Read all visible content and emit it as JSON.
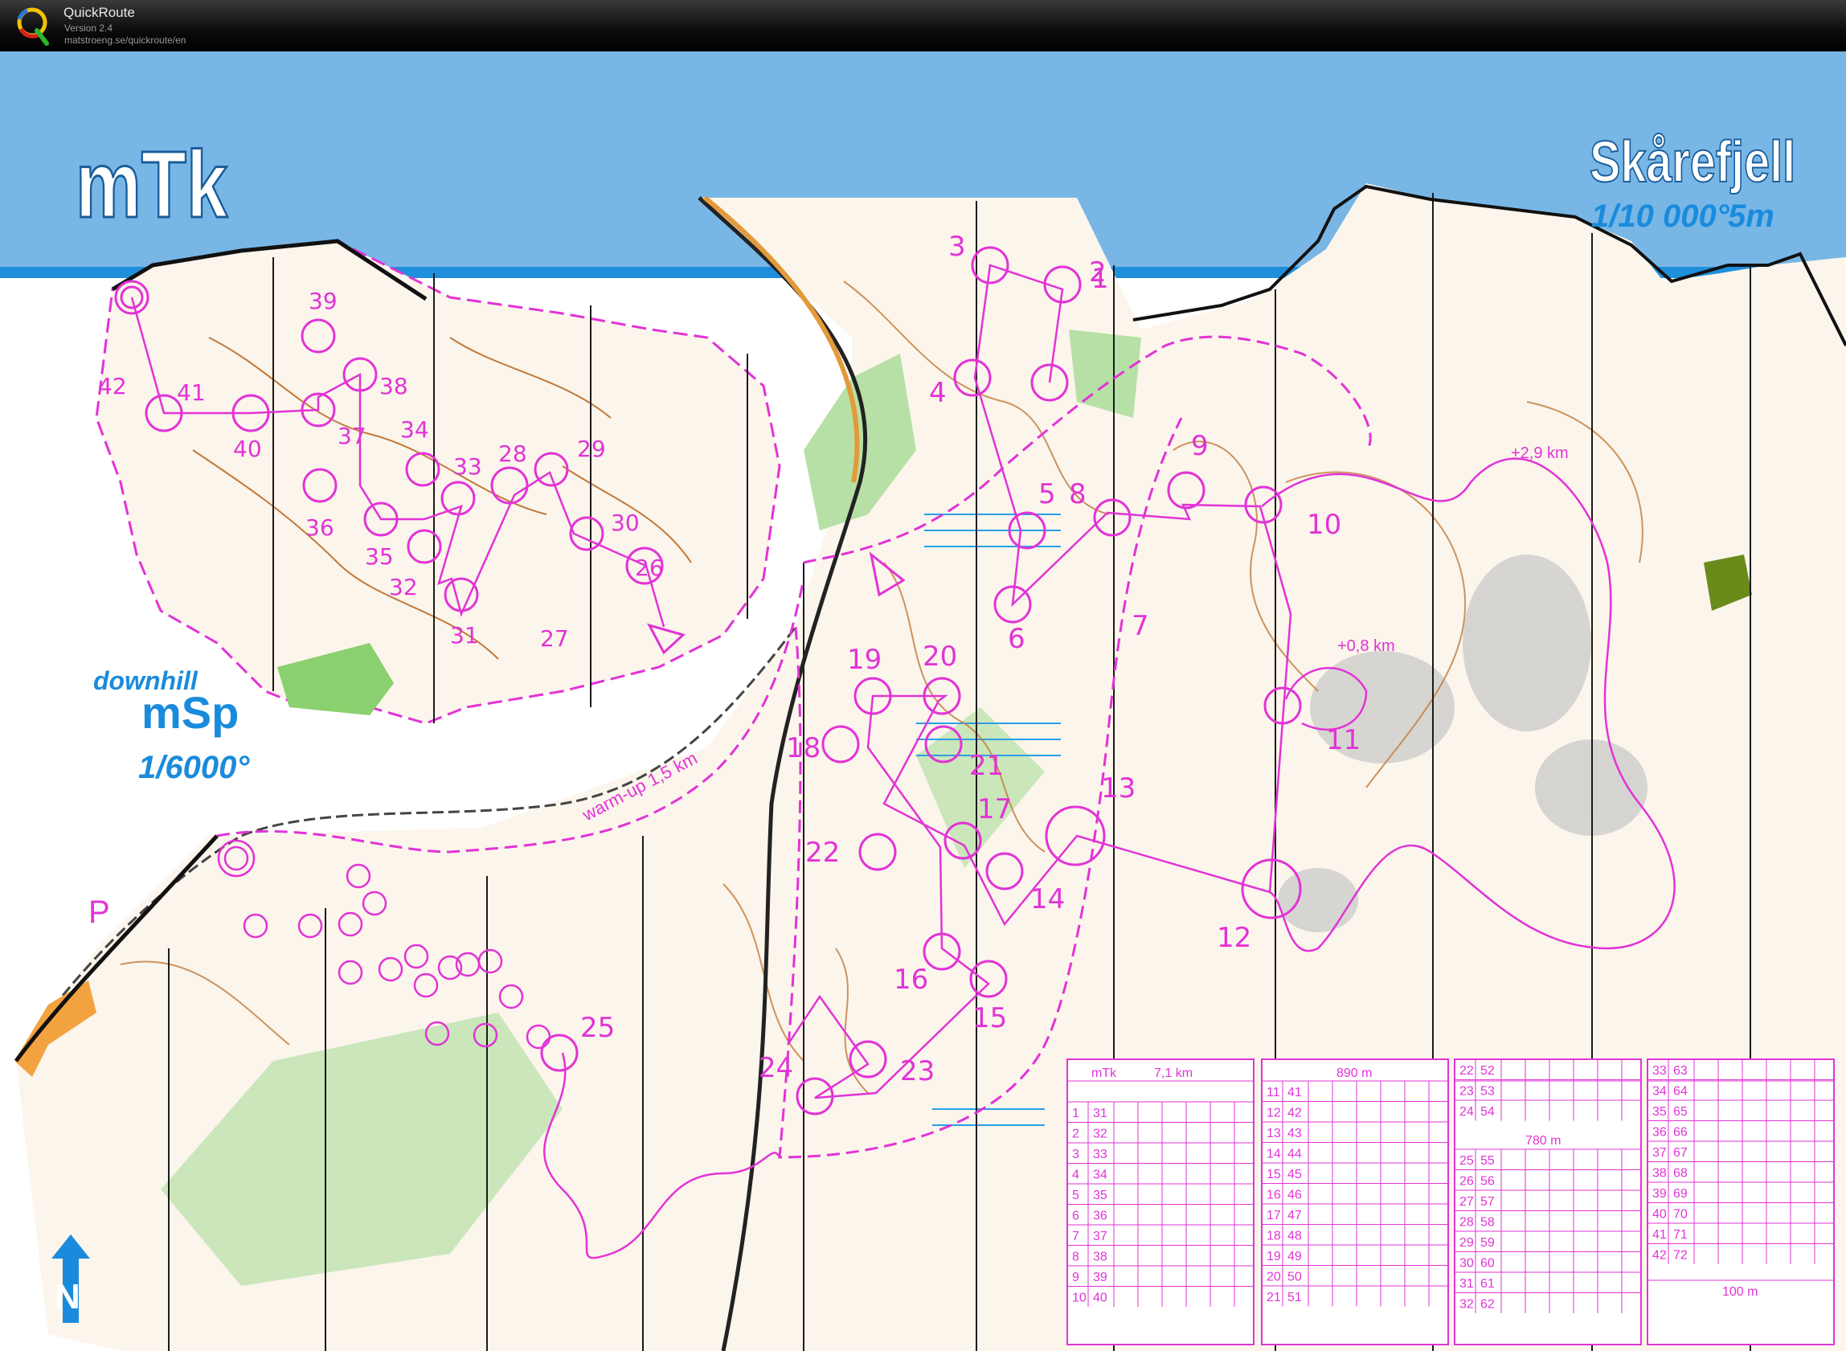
{
  "app": {
    "name": "QuickRoute",
    "version": "Version 2.4",
    "url": "matstroeng.se/quickroute/en",
    "icon_name": "quickroute-logo-icon"
  },
  "map": {
    "event_title": "mTk",
    "area_name": "Skårefjell",
    "scale": "1/10 000°",
    "contour": "5m",
    "inset_caption_1": "downhill",
    "inset_caption_2": "mSp",
    "inset_scale": "1/6000°",
    "parking_label": "P",
    "warmup_label": "warm-up  1,5 km",
    "loop_label_long": "+2,9 km",
    "loop_label_short": "+0,8 km",
    "north_arrow_icon": "north-arrow-icon",
    "colors": {
      "course": "#e233d6",
      "header_blue": "#78b6e6",
      "water_blue": "#1a9ae0",
      "title_white": "#ffffff"
    },
    "main_controls": [
      "1",
      "2",
      "3",
      "4",
      "5",
      "6",
      "7",
      "8",
      "9",
      "10",
      "11",
      "12",
      "13",
      "14",
      "15",
      "16",
      "17",
      "18",
      "19",
      "20",
      "21",
      "22",
      "23",
      "24",
      "25"
    ],
    "sprint_controls": [
      "26",
      "27",
      "28",
      "29",
      "30",
      "31",
      "32",
      "33",
      "34",
      "35",
      "36",
      "37",
      "38",
      "39",
      "40",
      "41",
      "42"
    ]
  },
  "descriptions": {
    "header_course": "mTk",
    "header_length": "7,1 km",
    "distance_1": "890 m",
    "distance_2": "780 m",
    "distance_3": "100 m",
    "col1": [
      [
        "1",
        "31"
      ],
      [
        "2",
        "32"
      ],
      [
        "3",
        "33"
      ],
      [
        "4",
        "34"
      ],
      [
        "5",
        "35"
      ],
      [
        "6",
        "36"
      ],
      [
        "7",
        "37"
      ],
      [
        "8",
        "38"
      ],
      [
        "9",
        "39"
      ],
      [
        "10",
        "40"
      ]
    ],
    "col2": [
      [
        "11",
        "41"
      ],
      [
        "12",
        "42"
      ],
      [
        "13",
        "43"
      ],
      [
        "14",
        "44"
      ],
      [
        "15",
        "45"
      ],
      [
        "16",
        "46"
      ],
      [
        "17",
        "47"
      ],
      [
        "18",
        "48"
      ],
      [
        "19",
        "49"
      ],
      [
        "20",
        "50"
      ],
      [
        "21",
        "51"
      ]
    ],
    "col3a": [
      [
        "22",
        "52"
      ],
      [
        "23",
        "53"
      ],
      [
        "24",
        "54"
      ]
    ],
    "col3b": [
      [
        "25",
        "55"
      ],
      [
        "26",
        "56"
      ],
      [
        "27",
        "57"
      ],
      [
        "28",
        "58"
      ],
      [
        "29",
        "59"
      ],
      [
        "30",
        "60"
      ],
      [
        "31",
        "61"
      ],
      [
        "32",
        "62"
      ]
    ],
    "col4": [
      [
        "33",
        "63"
      ],
      [
        "34",
        "64"
      ],
      [
        "35",
        "65"
      ],
      [
        "36",
        "66"
      ],
      [
        "37",
        "67"
      ],
      [
        "38",
        "68"
      ],
      [
        "39",
        "69"
      ],
      [
        "40",
        "70"
      ],
      [
        "41",
        "71"
      ],
      [
        "42",
        "72"
      ]
    ]
  }
}
